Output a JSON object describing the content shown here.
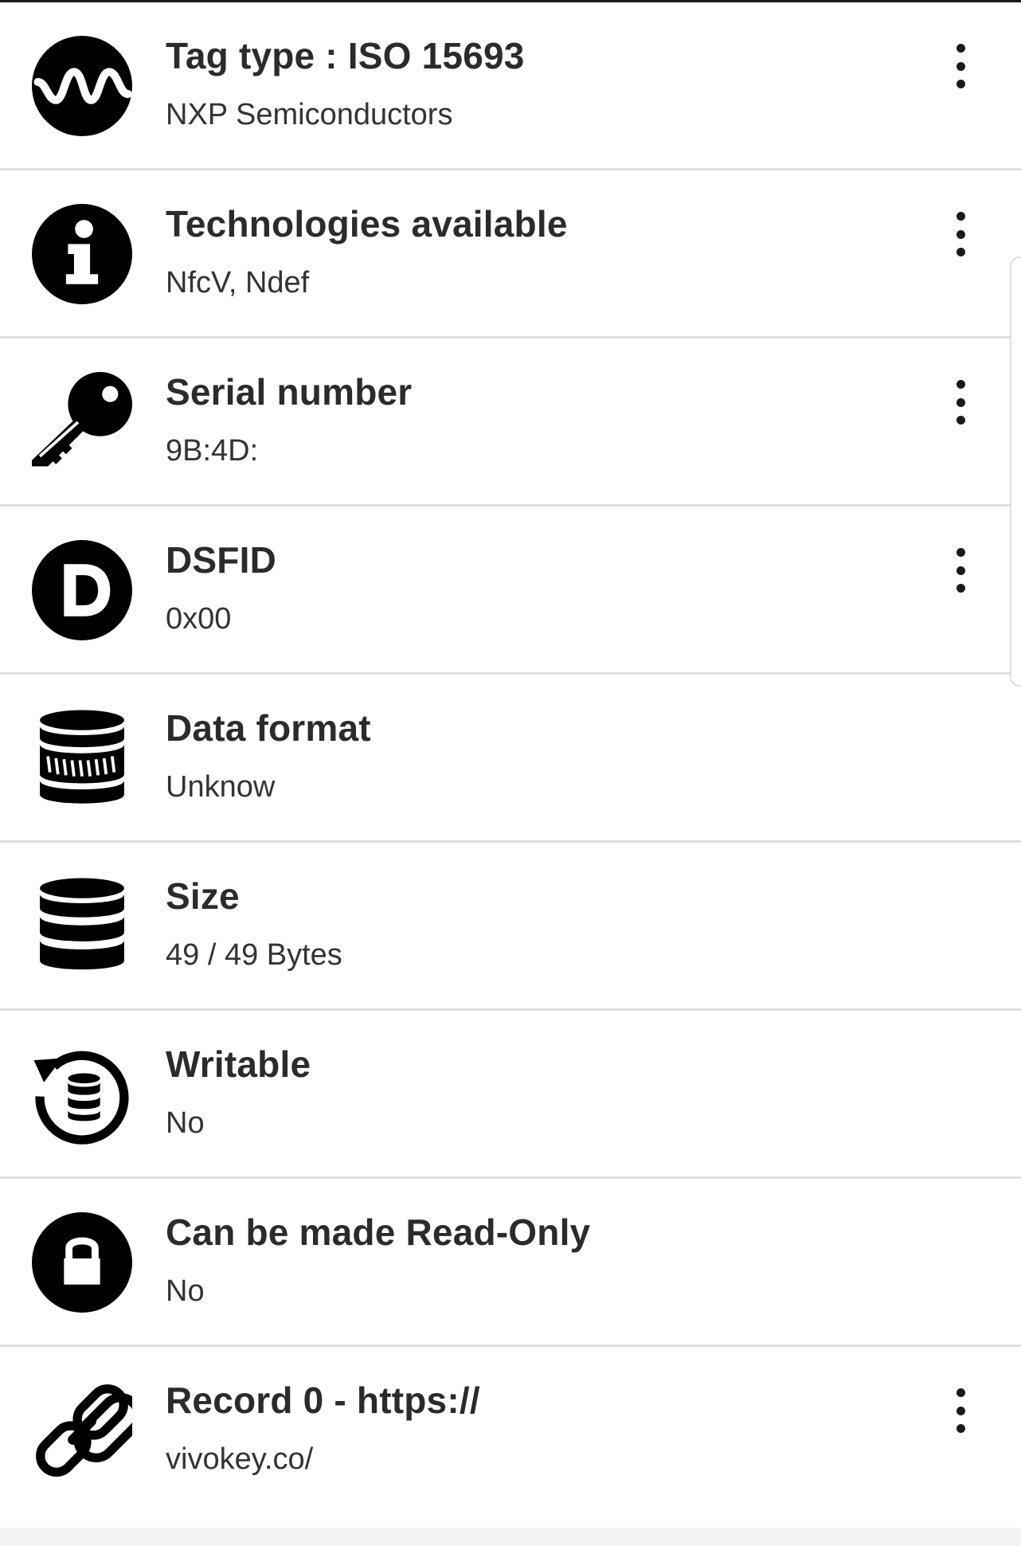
{
  "rows": [
    {
      "title": "Tag type : ISO 15693",
      "value": "NXP Semiconductors",
      "icon": "waveform-icon",
      "has_menu": true
    },
    {
      "title": "Technologies available",
      "value": "NfcV, Ndef",
      "icon": "info-icon",
      "has_menu": true
    },
    {
      "title": "Serial number",
      "value": "9B:4D:",
      "icon": "key-icon",
      "has_menu": true
    },
    {
      "title": "DSFID",
      "value": "0x00",
      "icon": "letter-d-icon",
      "has_menu": true
    },
    {
      "title": "Data format",
      "value": "Unknow",
      "icon": "database-format-icon",
      "has_menu": false
    },
    {
      "title": "Size",
      "value": "49 / 49 Bytes",
      "icon": "database-icon",
      "has_menu": false
    },
    {
      "title": "Writable",
      "value": "No",
      "icon": "database-rewrite-icon",
      "has_menu": false
    },
    {
      "title": "Can be made Read-Only",
      "value": "No",
      "icon": "lock-icon",
      "has_menu": false
    },
    {
      "title": "Record 0 - https://",
      "value": "vivokey.co/",
      "icon": "link-icon",
      "has_menu": true
    }
  ],
  "colors": {
    "icon": "#000000",
    "title": "#2b2b2b",
    "value": "#333333",
    "divider": "#dedede"
  }
}
